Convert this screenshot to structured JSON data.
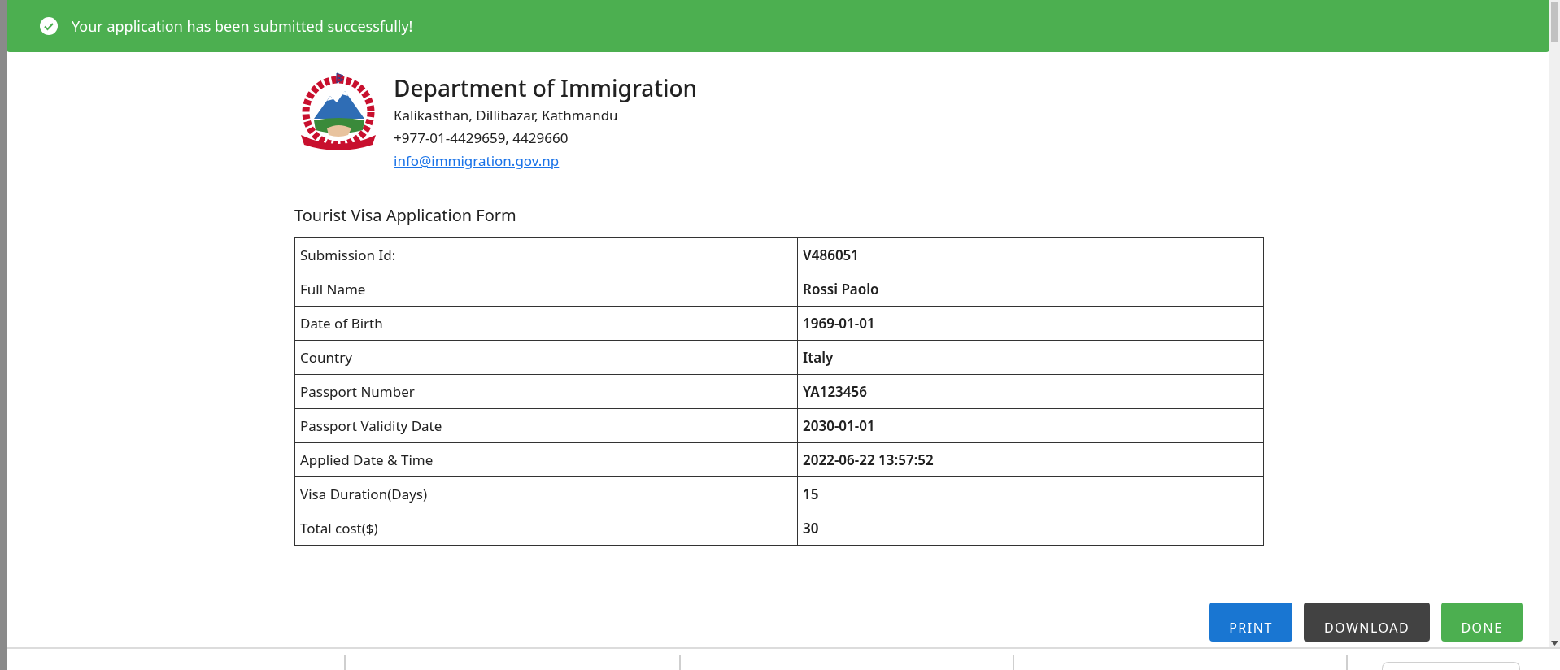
{
  "alert": {
    "message": "Your application has been submitted successfully!"
  },
  "office": {
    "name": "Department of Immigration",
    "address": "Kalikasthan, Dillibazar, Kathmandu",
    "phone": "+977-01-4429659, 4429660",
    "email": "info@immigration.gov.np"
  },
  "form": {
    "title": "Tourist Visa Application Form",
    "rows": [
      {
        "label": "Submission Id:",
        "value": "V486051"
      },
      {
        "label": "Full Name",
        "value": "Rossi Paolo"
      },
      {
        "label": "Date of Birth",
        "value": "1969-01-01"
      },
      {
        "label": "Country",
        "value": "Italy"
      },
      {
        "label": "Passport Number",
        "value": "YA123456"
      },
      {
        "label": "Passport Validity Date",
        "value": "2030-01-01"
      },
      {
        "label": "Applied Date & Time",
        "value": "2022-06-22 13:57:52"
      },
      {
        "label": "Visa Duration(Days)",
        "value": "15"
      },
      {
        "label": "Total cost($)",
        "value": "30"
      }
    ]
  },
  "buttons": [
    {
      "label": "PRINT",
      "kind": "primary"
    },
    {
      "label": "DOWNLOAD",
      "kind": "dark"
    },
    {
      "label": "DONE",
      "kind": "success"
    }
  ]
}
